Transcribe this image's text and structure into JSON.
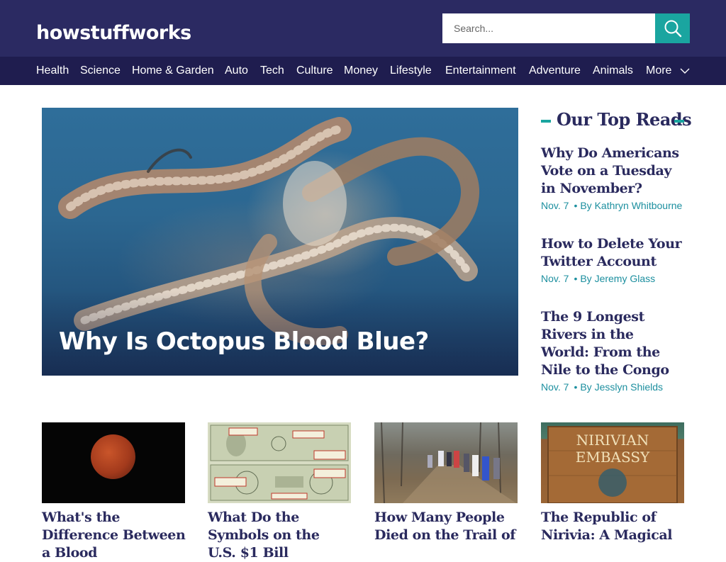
{
  "header": {
    "logo_text": "howstuffworks",
    "search_placeholder": "Search...",
    "accent_color": "#1aa5a0",
    "bar_color": "#2b2a62",
    "nav_color": "#1f1d4f"
  },
  "nav": {
    "items": [
      "Health",
      "Science",
      "Home & Garden",
      "Auto",
      "Tech",
      "Culture",
      "Money",
      "Lifestyle",
      "Entertainment",
      "Adventure",
      "Animals"
    ],
    "more_label": "More",
    "more_icon": "chevron-down-icon"
  },
  "hero": {
    "title": "Why Is Octopus Blood Blue?",
    "image_subject": "octopus"
  },
  "top_reads": {
    "heading": "Our Top Reads",
    "items": [
      {
        "title": "Why Do Americans Vote on a Tuesday in November?",
        "date": "Nov. 7",
        "author": "By Kathryn Whitbourne"
      },
      {
        "title": "How to Delete Your Twitter Account",
        "date": "Nov. 7",
        "author": "By Jeremy Glass"
      },
      {
        "title": "The 9 Longest Rivers in the World: From the Nile to the Congo",
        "date": "Nov. 7",
        "author": "By Jesslyn Shields"
      }
    ]
  },
  "cards": [
    {
      "title": "What's the Difference Between a Blood",
      "image_subject": "moon"
    },
    {
      "title": "What Do the Symbols on the U.S. $1 Bill",
      "image_subject": "dollar-bill"
    },
    {
      "title": "How Many People Died on the Trail of",
      "image_subject": "trail"
    },
    {
      "title": "The Republic of Nirivia: A Magical",
      "image_subject": "embassy-sign",
      "image_text_1": "NIRIVIAN",
      "image_text_2": "EMBASSY"
    }
  ]
}
